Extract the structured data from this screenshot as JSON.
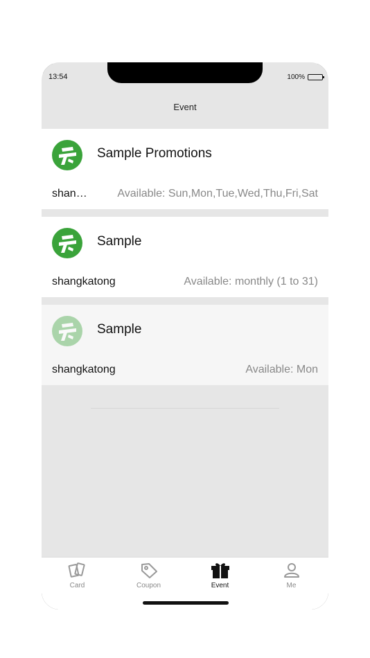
{
  "status_bar": {
    "time": "13:54",
    "battery_percent": "100%",
    "battery_level": 1.0
  },
  "nav": {
    "title": "Event"
  },
  "events": [
    {
      "title": "Sample Promotions",
      "merchant": "shangkatong",
      "availability": "Available: Sun,Mon,Tue,Wed,Thu,Fri,Sat",
      "logo_icon": "card-logo-icon"
    },
    {
      "title": "Sample",
      "merchant": "shangkatong",
      "availability": "Available: monthly (1 to 31)",
      "logo_icon": "card-logo-icon"
    },
    {
      "title": "Sample",
      "merchant": "shangkatong",
      "availability": "Available: Mon",
      "logo_icon": "card-logo-icon"
    }
  ],
  "tabs": [
    {
      "label": "Card",
      "icon": "cards-icon",
      "active": false
    },
    {
      "label": "Coupon",
      "icon": "tag-icon",
      "active": false
    },
    {
      "label": "Event",
      "icon": "gift-icon",
      "active": true
    },
    {
      "label": "Me",
      "icon": "person-icon",
      "active": false
    }
  ],
  "colors": {
    "logo_green": "#3aa33a",
    "background": "#e6e6e6",
    "muted_text": "#888888"
  }
}
